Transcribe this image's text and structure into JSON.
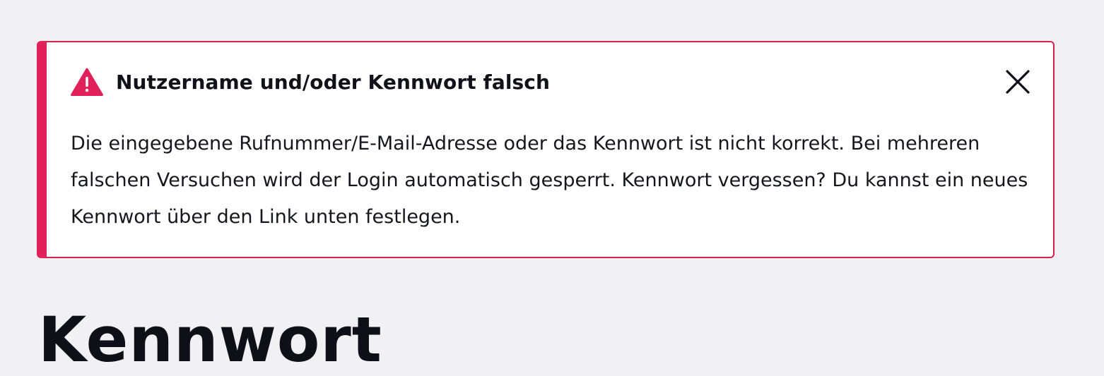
{
  "alert": {
    "title": "Nutzername und/oder Kennwort falsch",
    "message": "Die eingegebene Rufnummer/E-Mail-Adresse oder das Kennwort ist nicht korrekt. Bei mehreren falschen Versuchen wird der Login automatisch gesperrt. Kennwort vergessen? Du kannst ein neues Kennwort über den Link unten festlegen.",
    "icon": "warning-triangle-icon",
    "close_icon": "close-icon",
    "accent_color": "#e0215a",
    "type": "error"
  },
  "page": {
    "title": "Kennwort"
  }
}
